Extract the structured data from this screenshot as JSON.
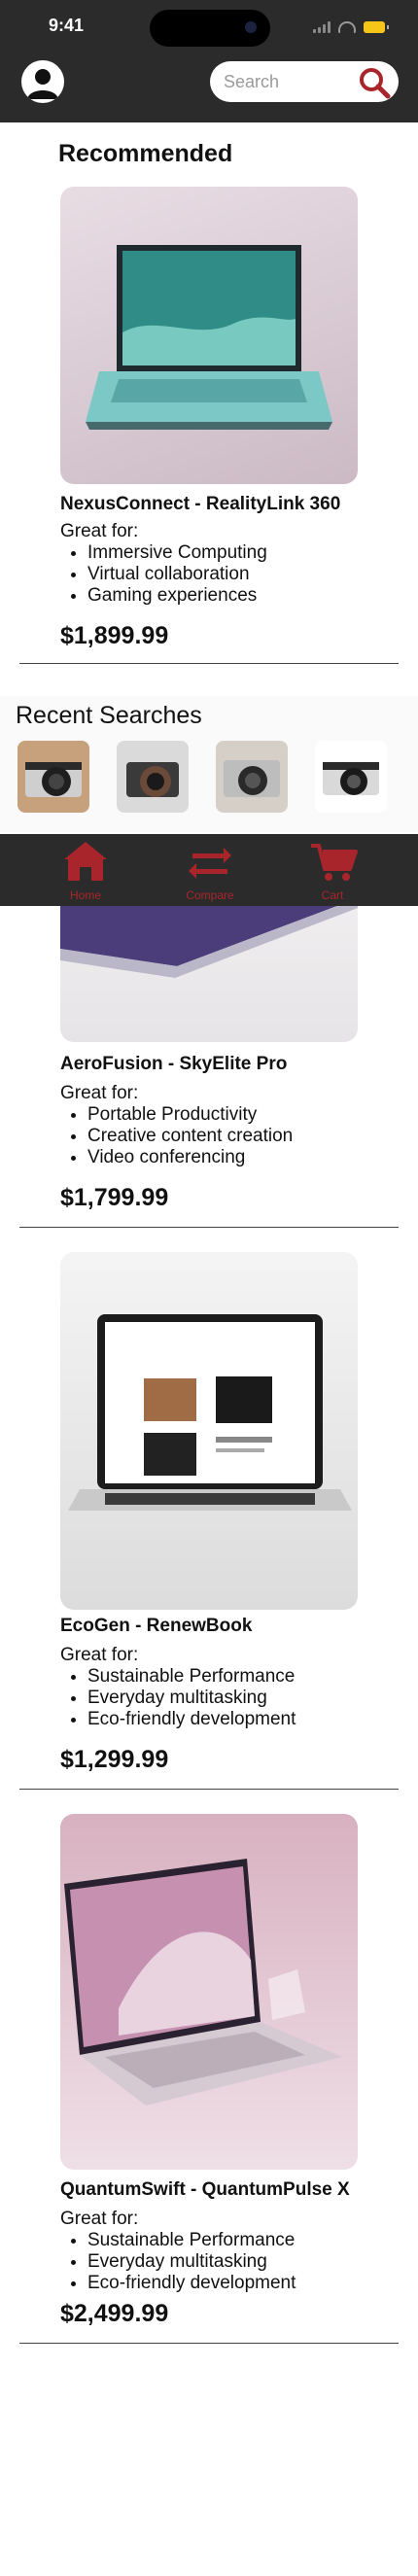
{
  "status_bar": {
    "time": "9:41"
  },
  "header": {
    "search_placeholder": "Search"
  },
  "recommended": {
    "title": "Recommended",
    "product": {
      "name": "NexusConnect -  RealityLink 360",
      "great_for_label": "Great for:",
      "uses": [
        "Immersive Computing",
        "Virtual collaboration",
        "Gaming experiences"
      ],
      "price": "$1,899.99"
    }
  },
  "recent_searches": {
    "title": "Recent Searches",
    "items": [
      "camera-1",
      "camera-2",
      "camera-3",
      "camera-4"
    ]
  },
  "bottom_nav": {
    "items": [
      {
        "label": "Home",
        "icon": "home-icon"
      },
      {
        "label": "Compare",
        "icon": "compare-icon"
      },
      {
        "label": "Cart",
        "icon": "cart-icon"
      }
    ],
    "accent": "#a8262b"
  },
  "products": [
    {
      "name": "AeroFusion - SkyElite Pro",
      "great_for_label": "Great for:",
      "uses": [
        "Portable Productivity",
        "Creative content creation",
        "Video conferencing"
      ],
      "price": "$1,799.99"
    },
    {
      "name": "EcoGen - RenewBook",
      "great_for_label": "Great for:",
      "uses": [
        "Sustainable Performance",
        "Everyday multitasking",
        "Eco-friendly development"
      ],
      "price": "$1,299.99"
    },
    {
      "name": "QuantumSwift - QuantumPulse X",
      "great_for_label": "Great for:",
      "uses": [
        "Sustainable Performance",
        "Everyday multitasking",
        "Eco-friendly development"
      ],
      "price": "$2,499.99"
    }
  ]
}
